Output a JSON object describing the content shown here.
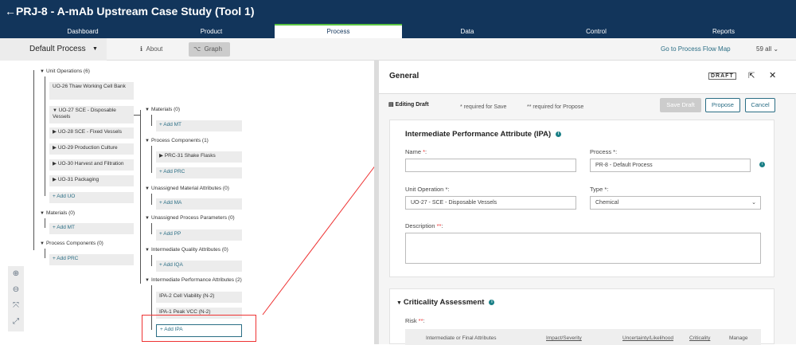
{
  "header": {
    "back": "←",
    "title": "PRJ-8 - A-mAb Upstream Case Study (Tool 1)"
  },
  "tabs": [
    "Dashboard",
    "Product",
    "Process",
    "Data",
    "Control",
    "Reports"
  ],
  "subbar": {
    "process": "Default Process",
    "about": "About",
    "graph": "Graph",
    "goto": "Go to Process Flow Map",
    "count": "59 all"
  },
  "tree": {
    "unit_ops": "Unit Operations (6)",
    "uo": [
      "UO-26 Thaw Working Cell Bank",
      "UO-27 SCE - Disposable Vessels",
      "UO-28 SCE - Fixed Vessels",
      "UO-29 Production Culture",
      "UO-30 Harvest and Filtration",
      "UO-31 Packaging"
    ],
    "add_uo": "+ Add UO",
    "materials": "Materials (0)",
    "add_mt": "+ Add MT",
    "proc_comp": "Process Components (0)",
    "add_prc": "+ Add PRC",
    "r_materials": "Materials (0)",
    "r_add_mt": "+ Add MT",
    "r_pc": "Process Components (1)",
    "r_prc31": "PRC-31 Shake Flasks",
    "r_add_prc": "+ Add PRC",
    "r_uma": "Unassigned Material Attributes (0)",
    "r_add_ma": "+ Add MA",
    "r_upp": "Unassigned Process Parameters (0)",
    "r_add_pp": "+ Add PP",
    "r_iqa": "Intermediate Quality Attributes (0)",
    "r_add_iqa": "+ Add IQA",
    "r_ipa": "Intermediate Performance Attributes (2)",
    "ipa2": "IPA-2 Cell Viability (N-2)",
    "ipa1": "IPA-1 Peak VCC (N-2)",
    "add_ipa": "+ Add IPA"
  },
  "panel": {
    "title": "General",
    "draft": "DRAFT",
    "editing": "Editing Draft",
    "req_save": "* required for Save",
    "req_propose": "** required for Propose",
    "save_draft": "Save Draft",
    "propose": "Propose",
    "cancel": "Cancel",
    "card_title": "Intermediate Performance Attribute (IPA)",
    "name_label": "Name ",
    "process_label": "Process *:",
    "process_value": "PR-8 - Default Process",
    "uo_label": "Unit Operation *:",
    "uo_value": "UO-27 - SCE - Disposable Vessels",
    "type_label": "Type *:",
    "type_value": "Chemical",
    "desc_label": "Description ",
    "crit_title": "Criticality Assessment",
    "risk_label": "Risk ",
    "cols": [
      "Intermediate or Final Attributes",
      "Impact/Severity",
      "Uncertainty/Likelihood",
      "Criticality",
      "Manage"
    ]
  }
}
